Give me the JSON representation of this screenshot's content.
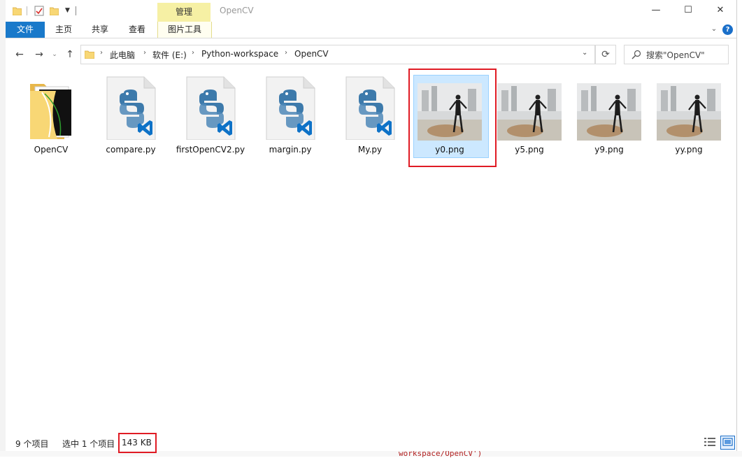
{
  "window": {
    "title": "OpenCV",
    "context_tab_group": "管理",
    "controls": {
      "minimize": "—",
      "maximize": "☐",
      "close": "✕"
    }
  },
  "ribbon": {
    "tabs": [
      {
        "label": "文件"
      },
      {
        "label": "主页"
      },
      {
        "label": "共享"
      },
      {
        "label": "查看"
      },
      {
        "label": "图片工具"
      }
    ],
    "help": "?"
  },
  "address": {
    "breadcrumbs": [
      "此电脑",
      "软件 (E:)",
      "Python-workspace",
      "OpenCV"
    ]
  },
  "search": {
    "placeholder": "搜索\"OpenCV\""
  },
  "files": [
    {
      "name": "OpenCV",
      "type": "folder"
    },
    {
      "name": "compare.py",
      "type": "python"
    },
    {
      "name": "firstOpenCV2.py",
      "type": "python"
    },
    {
      "name": "margin.py",
      "type": "python"
    },
    {
      "name": "My.py",
      "type": "python"
    },
    {
      "name": "y0.png",
      "type": "image",
      "selected": true
    },
    {
      "name": "y5.png",
      "type": "image"
    },
    {
      "name": "y9.png",
      "type": "image"
    },
    {
      "name": "yy.png",
      "type": "image"
    }
  ],
  "status": {
    "item_count": "9 个项目",
    "selected": "选中 1 个项目",
    "size": "143 KB"
  },
  "background_code": {
    "bottom": "workspace/OpenCV')"
  },
  "colors": {
    "accent": "#1979ca",
    "selection": "#cce8ff",
    "highlight": "#e01b24",
    "context_tab": "#f6f0a4"
  }
}
